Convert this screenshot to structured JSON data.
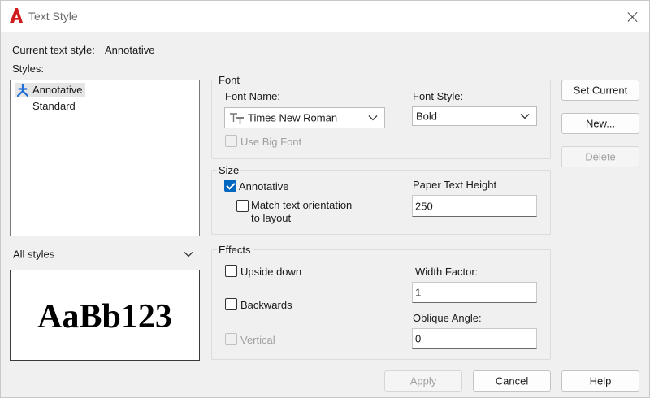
{
  "window": {
    "title": "Text Style",
    "app_icon": "autocad-a-icon"
  },
  "current_style": {
    "label": "Current text style:",
    "value": "Annotative"
  },
  "styles": {
    "label": "Styles:",
    "items": [
      {
        "label": "Annotative",
        "selected": true,
        "icon": "annotative-icon"
      },
      {
        "label": "Standard",
        "selected": false
      }
    ],
    "filter_selected": "All styles"
  },
  "preview": {
    "text": "AaBb123"
  },
  "font": {
    "group_title": "Font",
    "name_label": "Font Name:",
    "name_value": "Times New Roman",
    "name_icon": "truetype-font-icon",
    "style_label": "Font Style:",
    "style_value": "Bold",
    "big_font_label": "Use Big Font",
    "big_font_checked": false
  },
  "size": {
    "group_title": "Size",
    "annotative_label": "Annotative",
    "annotative_checked": true,
    "match_label_line1": "Match text orientation",
    "match_label_line2": "to layout",
    "match_checked": false,
    "height_label": "Paper Text Height",
    "height_value": "250"
  },
  "effects": {
    "group_title": "Effects",
    "upside_down_label": "Upside down",
    "backwards_label": "Backwards",
    "vertical_label": "Vertical",
    "width_label": "Width Factor:",
    "width_value": "1",
    "oblique_label": "Oblique Angle:",
    "oblique_value": "0"
  },
  "buttons": {
    "set_current": "Set Current",
    "new": "New...",
    "delete": "Delete",
    "apply": "Apply",
    "cancel": "Cancel",
    "help": "Help"
  },
  "colors": {
    "accent": "#0067c0",
    "app_red": "#d01c1c",
    "annotative_blue": "#1e6fd9"
  }
}
